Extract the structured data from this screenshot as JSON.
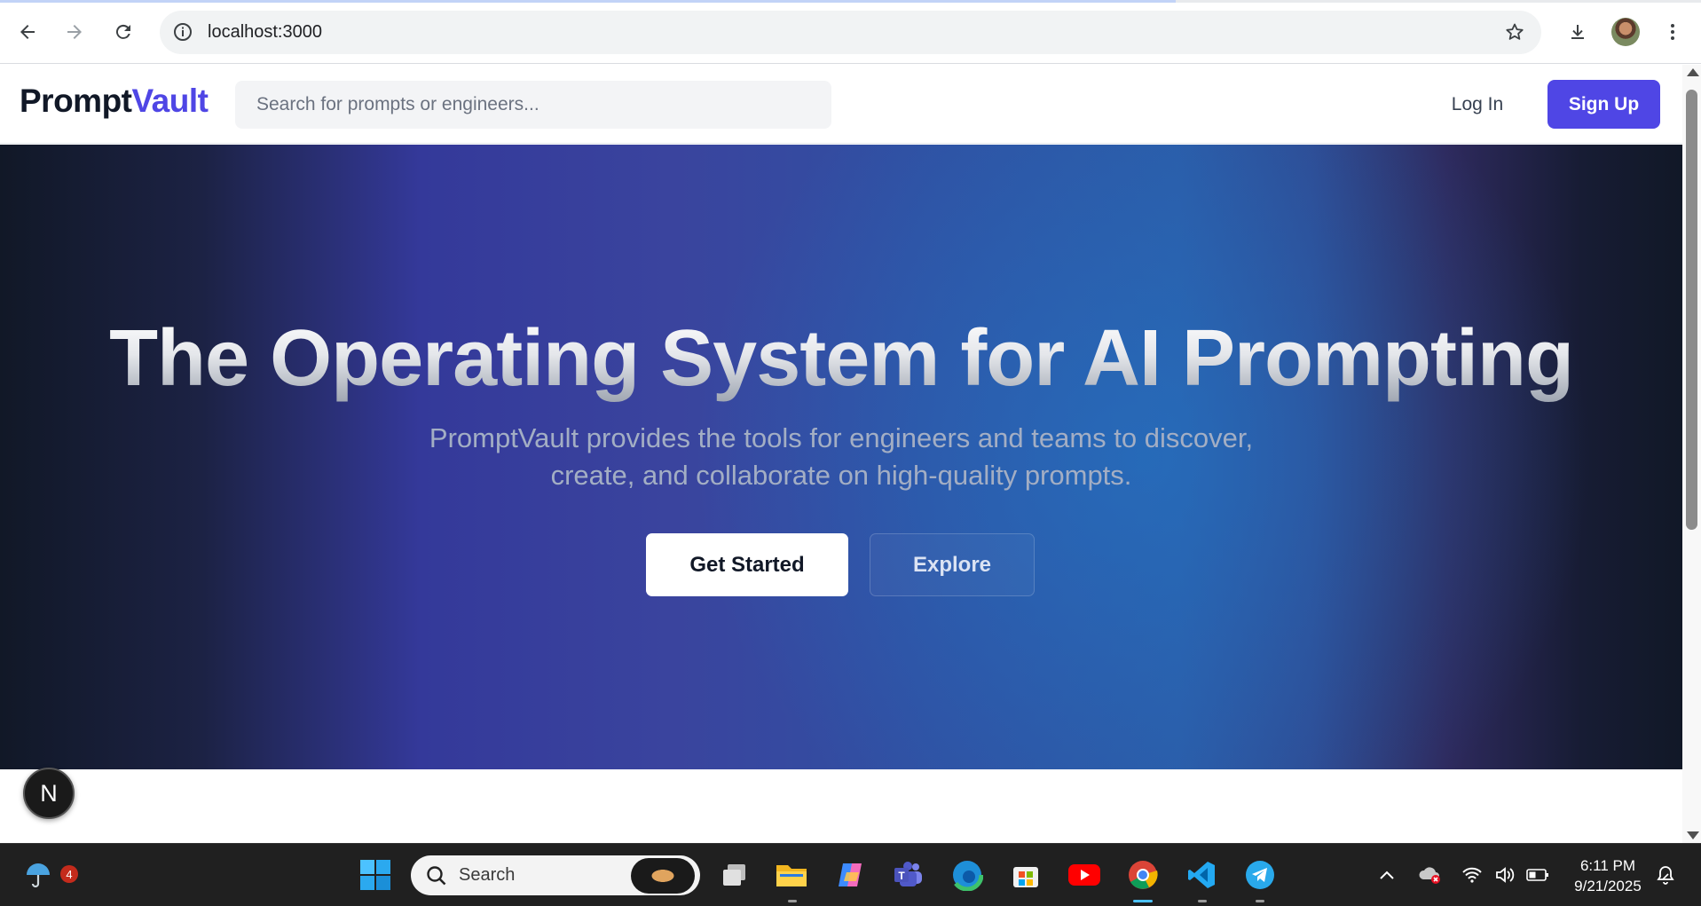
{
  "browser": {
    "url": "localhost:3000"
  },
  "site": {
    "logo_part1": "Prompt",
    "logo_part2": "Vault",
    "search_placeholder": "Search for prompts or engineers...",
    "login_label": "Log In",
    "signup_label": "Sign Up",
    "accent_color": "#4f46e5"
  },
  "hero": {
    "title": "The Operating System for AI Prompting",
    "subtitle_line1": "PromptVault provides the tools for engineers and teams to discover,",
    "subtitle_line2": "create, and collaborate on high-quality prompts.",
    "primary_button": "Get Started",
    "secondary_button": "Explore"
  },
  "dev_badge": {
    "letter": "N"
  },
  "taskbar": {
    "search_label": "Search",
    "weather_badge_count": "4",
    "time": "6:11 PM",
    "date": "9/21/2025",
    "pinned_apps": [
      "windows-start",
      "task-view",
      "file-explorer",
      "copilot",
      "teams",
      "edge",
      "microsoft-store",
      "youtube",
      "chrome",
      "vscode",
      "telegram"
    ]
  }
}
